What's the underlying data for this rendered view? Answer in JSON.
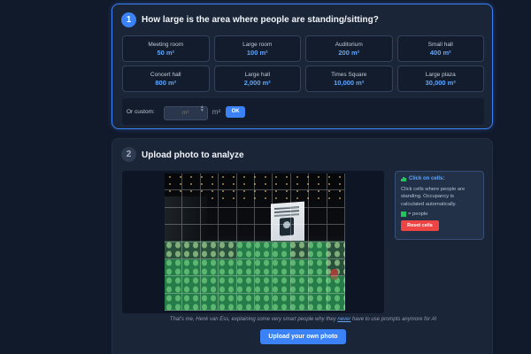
{
  "step1": {
    "number": "1",
    "title": "How large is the area where people are standing/sitting?",
    "options": [
      {
        "label": "Meeting room",
        "value": "50 m²"
      },
      {
        "label": "Large room",
        "value": "100 m²"
      },
      {
        "label": "Auditorium",
        "value": "200 m²"
      },
      {
        "label": "Small hall",
        "value": "400 m²"
      },
      {
        "label": "Concert hall",
        "value": "800 m²"
      },
      {
        "label": "Large hall",
        "value": "2,000 m²"
      },
      {
        "label": "Times Square",
        "value": "10,000 m²"
      },
      {
        "label": "Large plaza",
        "value": "30,000 m²"
      }
    ],
    "custom": {
      "label": "Or custom:",
      "placeholder": "m²",
      "unit": "m²",
      "ok_label": "OK"
    }
  },
  "step2": {
    "number": "2",
    "title": "Upload photo to analyze",
    "photo_icon": "crowd-photo",
    "side_panel": {
      "icon": "bar-chart-icon",
      "title": "Click on cells:",
      "text": "Click cells where people are standing. Occupancy is calculated automatically.",
      "legend": "= people",
      "reset_label": "Reset cells"
    },
    "caption_before": "That's me, Henk van Ess, explaining some very smart people why they ",
    "caption_link": "never",
    "caption_after": " have to use prompts anymore for AI",
    "upload_label": "Upload your own photo"
  },
  "colors": {
    "accent": "#3b82f6",
    "people": "#22c55e",
    "reset": "#ef4444"
  }
}
